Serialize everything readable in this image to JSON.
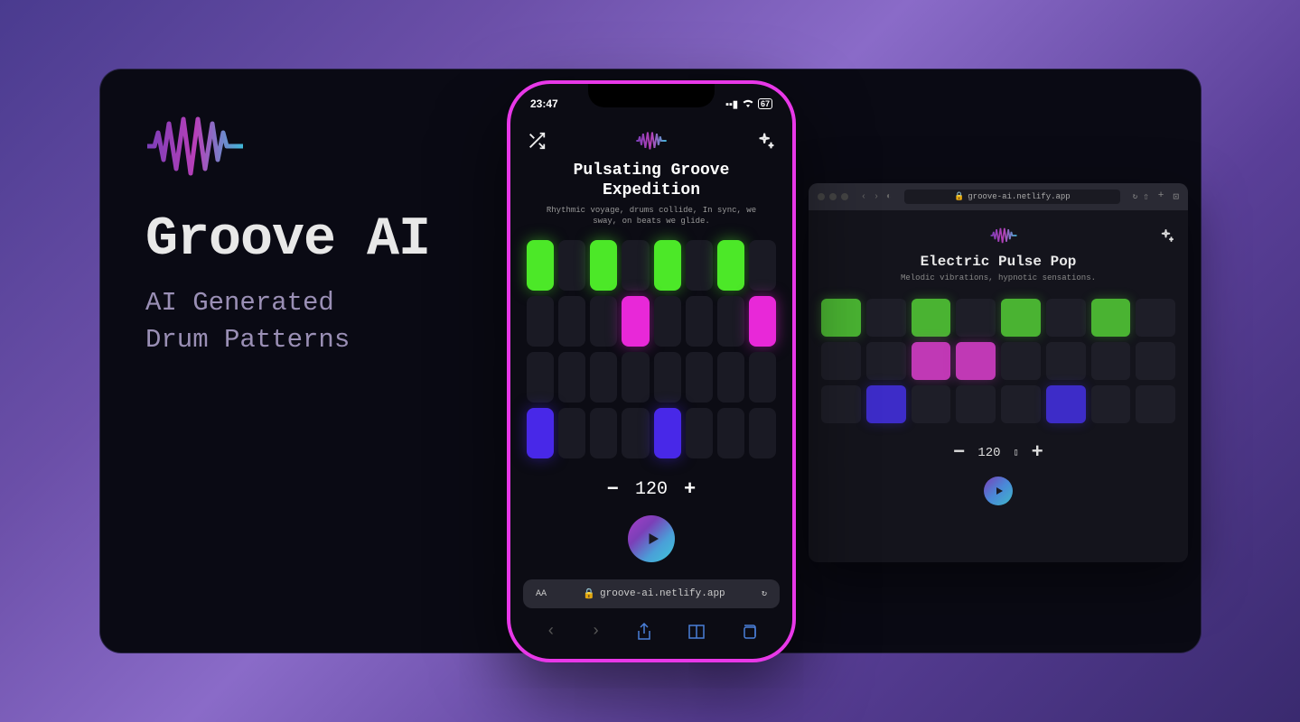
{
  "app": {
    "title": "Groove AI",
    "subtitle_line1": "AI Generated",
    "subtitle_line2": "Drum Patterns"
  },
  "phone": {
    "status_time": "23:47",
    "status_battery": "67",
    "title_line1": "Pulsating Groove",
    "title_line2": "Expedition",
    "description": "Rhythmic voyage, drums collide, In sync, we sway, on beats we glide.",
    "tempo": "120",
    "url": "groove-ai.netlify.app",
    "text_size": "AA",
    "grid": {
      "row1": [
        "green",
        "",
        "green",
        "",
        "green",
        "",
        "green",
        ""
      ],
      "row2": [
        "",
        "",
        "",
        "magenta",
        "",
        "",
        "",
        "magenta"
      ],
      "row3": [
        "",
        "",
        "",
        "",
        "",
        "",
        "",
        ""
      ],
      "row4": [
        "blue",
        "",
        "",
        "",
        "blue",
        "",
        "",
        ""
      ]
    }
  },
  "desktop": {
    "url": "groove-ai.netlify.app",
    "title": "Electric Pulse Pop",
    "description": "Melodic vibrations, hypnotic sensations.",
    "tempo": "120",
    "grid": {
      "row1": [
        "green",
        "",
        "green",
        "",
        "green",
        "",
        "green",
        ""
      ],
      "row2": [
        "",
        "",
        "magenta",
        "magenta",
        "",
        "",
        "",
        ""
      ],
      "row3": [
        "",
        "blue",
        "",
        "",
        "",
        "blue",
        "",
        ""
      ]
    }
  },
  "colors": {
    "green": "#4ce828",
    "magenta": "#e828d8",
    "blue": "#4828e8"
  }
}
